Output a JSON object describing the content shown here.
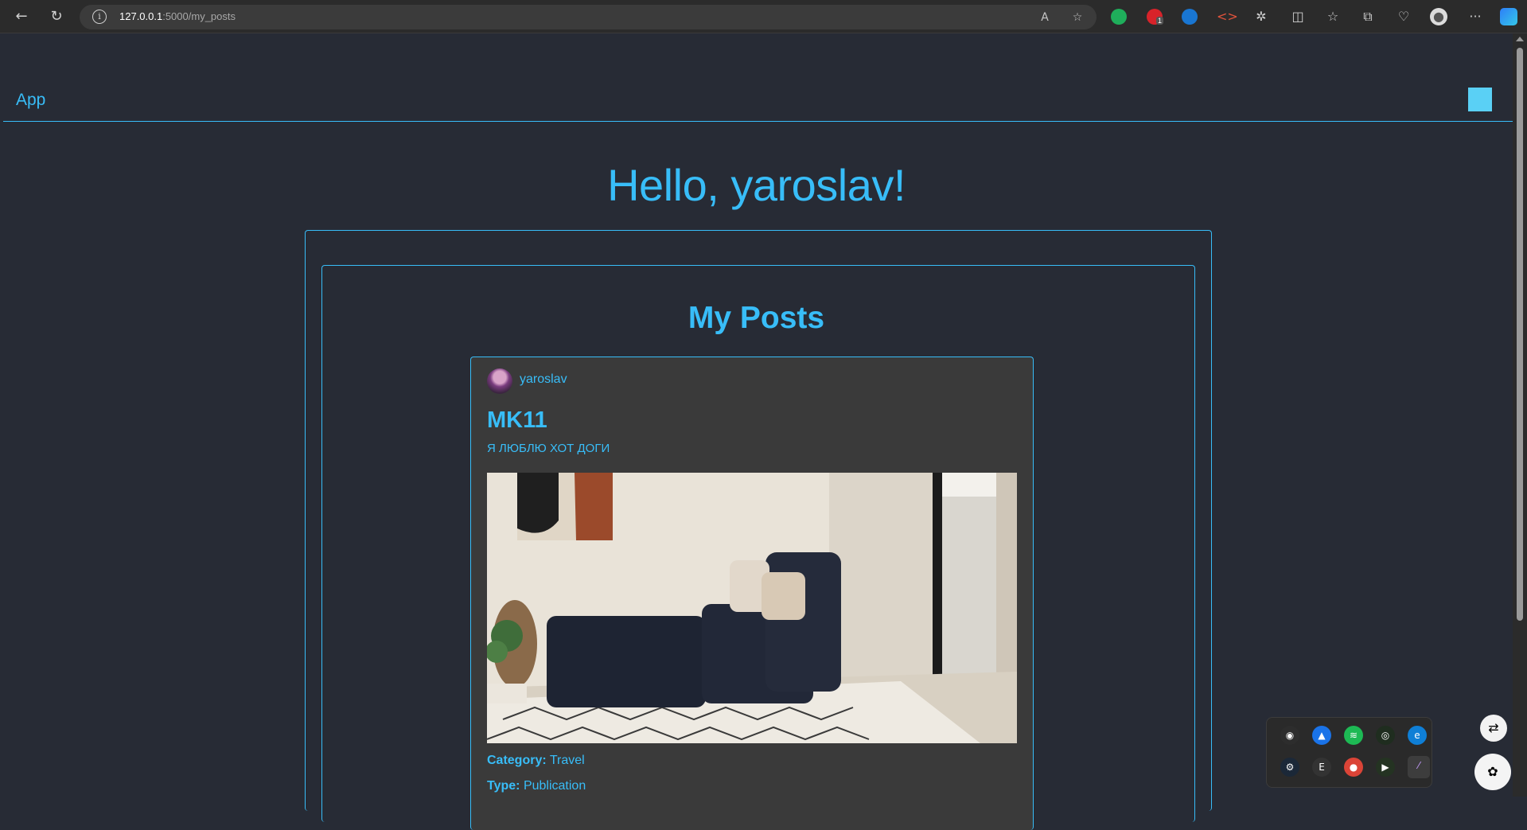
{
  "browser": {
    "url_host": "127.0.0.1",
    "url_rest": ":5000/my_posts",
    "extension_badge": "1"
  },
  "app": {
    "brand": "App"
  },
  "page": {
    "greeting": "Hello, yaroslav!",
    "section_title": "My Posts"
  },
  "post": {
    "author": "yaroslav",
    "title": "MK11",
    "body": "Я ЛЮБЛЮ ХОТ ДОГИ",
    "category_label": "Category:",
    "category_value": "Travel",
    "type_label": "Type:",
    "type_value": "Publication"
  },
  "colors": {
    "accent": "#38bdf8",
    "background": "#272b35",
    "card": "#3a3a3a"
  }
}
